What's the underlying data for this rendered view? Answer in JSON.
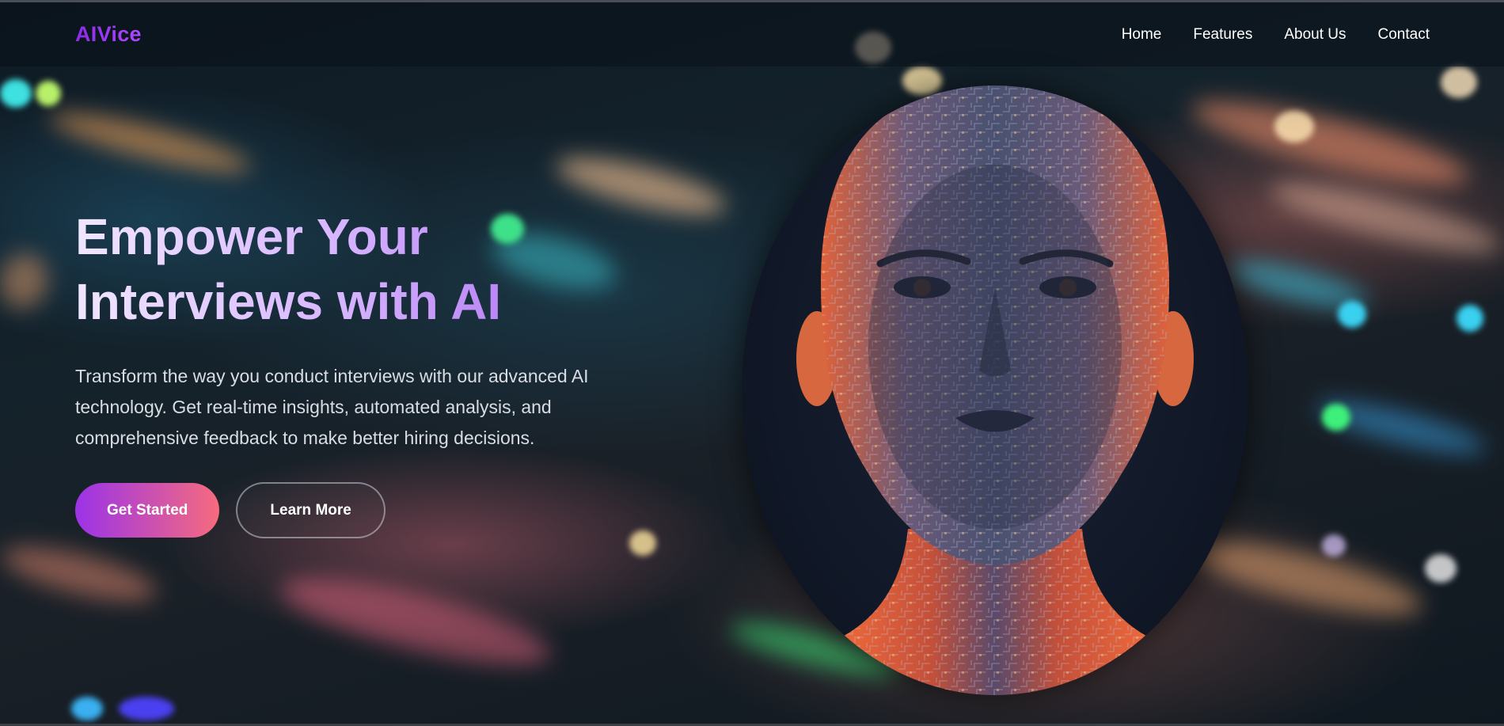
{
  "brand": {
    "logo": "AIVice"
  },
  "nav": {
    "links": [
      "Home",
      "Features",
      "About Us",
      "Contact"
    ]
  },
  "hero": {
    "headline_line1": "Empower Your",
    "headline_line2": "Interviews with AI",
    "description_line1": "Transform the way you conduct interviews with our advanced AI",
    "description_line2": "technology. Get real-time insights, automated analysis, and",
    "description_line3": "comprehensive feedback to make better hiring decisions.",
    "primary_button": "Get Started",
    "secondary_button": "Learn More"
  },
  "image": {
    "subject": "circuit-pattern-ai-head"
  },
  "colors": {
    "brand_purple": "#8b2be6",
    "button_gradient_start": "#9b33e8",
    "button_gradient_end": "#f66b7e",
    "headline_gradient_end": "#a35df0",
    "page_background": "#0b1119"
  }
}
